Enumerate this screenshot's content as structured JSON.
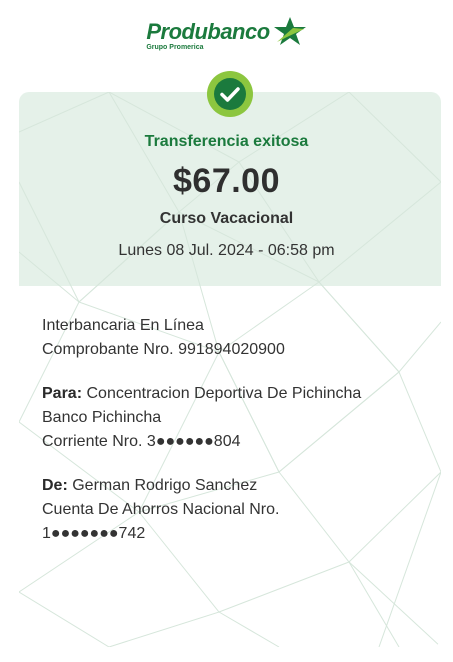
{
  "brand": {
    "name": "Produbanco",
    "sub": "Grupo Promerica",
    "color_primary": "#1b7a3d",
    "color_accent": "#8cc63f"
  },
  "receipt": {
    "status": "Transferencia exitosa",
    "amount": "$67.00",
    "concept": "Curso Vacacional",
    "datetime": "Lunes 08 Jul. 2024 - 06:58 pm",
    "transfer_type": "Interbancaria En Línea",
    "voucher": "Comprobante Nro. 991894020900",
    "to": {
      "label": "Para:",
      "name": "Concentracion Deportiva De Pichincha",
      "bank": "Banco Pichincha",
      "account": "Corriente Nro. 3●●●●●●804"
    },
    "from": {
      "label": "De:",
      "name": "German Rodrigo Sanchez",
      "account_type": "Cuenta De Ahorros Nacional Nro.",
      "account": "1●●●●●●●742"
    }
  },
  "icons": {
    "success": "check-circle-icon",
    "logo": "star-logo-icon"
  }
}
